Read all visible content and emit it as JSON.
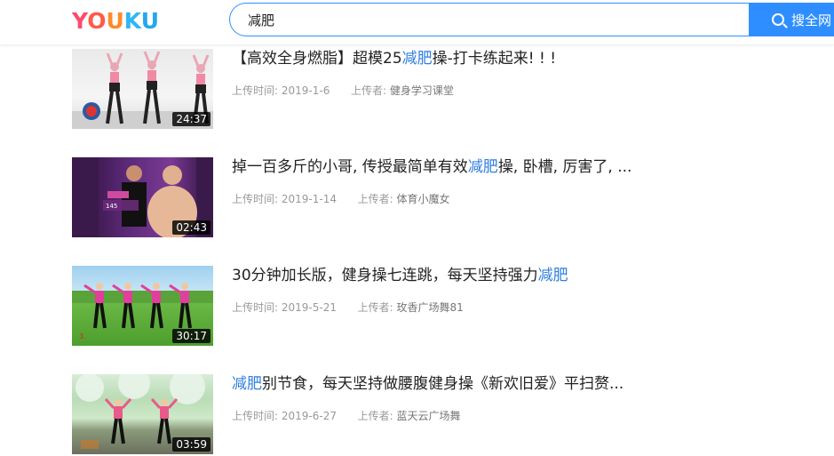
{
  "header": {
    "logo_letters": [
      "Y",
      "O",
      "U",
      "K",
      "U"
    ],
    "search_value": "减肥",
    "search_button_label": "搜全网"
  },
  "labels": {
    "upload_time": "上传时间:",
    "uploader": "上传者:"
  },
  "results": [
    {
      "title_before": "【高效全身燃脂】超模25",
      "title_highlight": "减肥",
      "title_after": "操-打卡练起来! ! !",
      "upload_time": "2019-1-6",
      "uploader": "健身学习课堂",
      "duration": "24:37"
    },
    {
      "title_before": "掉一百多斤的小哥, 传授最简单有效",
      "title_highlight": "减肥",
      "title_after": "操, 卧槽, 厉害了, ...",
      "upload_time": "2019-1-14",
      "uploader": "体育小魔女",
      "duration": "02:43"
    },
    {
      "title_before": "30分钟加长版，健身操七连跳，每天坚持强力",
      "title_highlight": "减肥",
      "title_after": "",
      "upload_time": "2019-5-21",
      "uploader": "玫香广场舞81",
      "duration": "30:17"
    },
    {
      "title_before": "",
      "title_highlight": "减肥",
      "title_after": "别节食，每天坚持做腰腹健身操《新欢旧爱》平扫赘...",
      "upload_time": "2019-6-27",
      "uploader": "蓝天云广场舞",
      "duration": "03:59"
    }
  ],
  "colors": {
    "accent": "#2f8eff",
    "highlight": "#2f7fe0"
  }
}
